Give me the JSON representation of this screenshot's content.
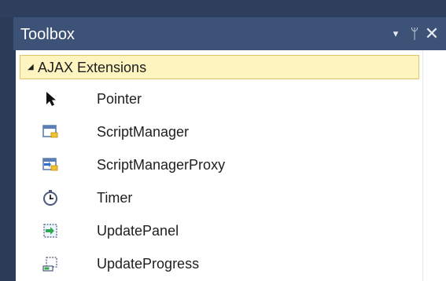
{
  "window": {
    "title": "Toolbox",
    "controls": {
      "dropdown": "▾",
      "pin": "ᛘ",
      "close": "✕"
    }
  },
  "group": {
    "label": "AJAX Extensions",
    "expanded": true
  },
  "items": [
    {
      "label": "Pointer",
      "icon": "pointer-icon"
    },
    {
      "label": "ScriptManager",
      "icon": "script-manager-icon"
    },
    {
      "label": "ScriptManagerProxy",
      "icon": "script-manager-proxy-icon"
    },
    {
      "label": "Timer",
      "icon": "timer-icon"
    },
    {
      "label": "UpdatePanel",
      "icon": "update-panel-icon"
    },
    {
      "label": "UpdateProgress",
      "icon": "update-progress-icon"
    }
  ],
  "colors": {
    "titlebar": "#3d5277",
    "frame": "#2b3c59",
    "group_header_fill": "#fdf4bf",
    "group_header_border": "#e5c365",
    "text": "#1e1e1e"
  }
}
